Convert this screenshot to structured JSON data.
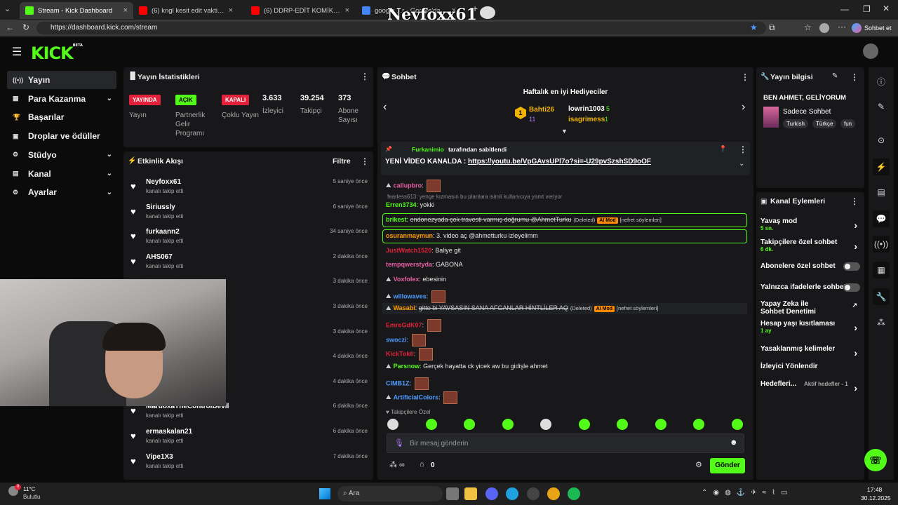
{
  "browser": {
    "tabs": [
      {
        "label": "Stream - Kick Dashboard",
        "color": "#53fc18"
      },
      {
        "label": "(6) kngl kesit edit vakti 1 - YouTub",
        "color": "#ff0000"
      },
      {
        "label": "(6) DDRP-EDİT KOMİK ANLAR 1 - Y",
        "color": "#ff0000"
      },
      {
        "label": "google ...r - Google'da Ara",
        "color": "#4285f4"
      }
    ],
    "url": "https://dashboard.kick.com/stream",
    "overlay_name": "Neyfoxx61",
    "profile_label": "Sohbet et"
  },
  "kick": {
    "logo": "KICK",
    "logo_sup": "BETA"
  },
  "sidebar": {
    "items": [
      {
        "label": "Yayın",
        "icon": "stream-icon",
        "selected": true,
        "chevron": false
      },
      {
        "label": "Para Kazanma",
        "icon": "money-icon",
        "chevron": true
      },
      {
        "label": "Başarılar",
        "icon": "trophy-icon",
        "chevron": false
      },
      {
        "label": "Droplar ve ödüller",
        "icon": "gift-icon",
        "chevron": false
      },
      {
        "label": "Stüdyo",
        "icon": "studio-icon",
        "chevron": true
      },
      {
        "label": "Kanal",
        "icon": "channel-icon",
        "chevron": true
      },
      {
        "label": "Ayarlar",
        "icon": "settings-icon",
        "chevron": true
      }
    ]
  },
  "stats": {
    "title": "Yayın İstatistikleri",
    "items": [
      {
        "badge": "YAYINDA",
        "badge_color": "#e3213b",
        "label": "Yayın"
      },
      {
        "badge": "AÇIK",
        "badge_color": "#53fc18",
        "label": "Partnerlik Gelir Programı"
      },
      {
        "badge": "KAPALI",
        "badge_color": "#e3213b",
        "label": "Çoklu Yayın"
      },
      {
        "value": "3.633",
        "label": "İzleyici"
      },
      {
        "value": "39.254",
        "label": "Takipçi"
      },
      {
        "value": "373",
        "label": "Abone Sayısı"
      }
    ]
  },
  "activity": {
    "title": "Etkinlik Akışı",
    "filter": "Filtre",
    "items": [
      {
        "name": "Neyfoxx61",
        "sub": "kanalı takip etti",
        "time": "5 saniye önce"
      },
      {
        "name": "Siriussly",
        "sub": "kanalı takip etti",
        "time": "6 saniye önce"
      },
      {
        "name": "furkaann2",
        "sub": "kanalı takip etti",
        "time": "34 saniye önce"
      },
      {
        "name": "AHS067",
        "sub": "kanalı takip etti",
        "time": "2 dakika önce"
      },
      {
        "name": "",
        "sub": "",
        "time": "3 dakika önce"
      },
      {
        "name": "",
        "sub": "",
        "time": "3 dakika önce"
      },
      {
        "name": "",
        "sub": "",
        "time": "3 dakika önce"
      },
      {
        "name": "",
        "sub": "",
        "time": "4 dakika önce"
      },
      {
        "name": "",
        "sub": "",
        "time": "4 dakika önce"
      },
      {
        "name": "MardoxaTheControlDevil",
        "sub": "kanalı takip etti",
        "time": "6 dakika önce"
      },
      {
        "name": "ermaskalan21",
        "sub": "kanalı takip etti",
        "time": "6 dakika önce"
      },
      {
        "name": "Vipe1X3",
        "sub": "kanalı takip etti",
        "time": "7 dakika önce"
      }
    ]
  },
  "chat": {
    "title": "Sohbet",
    "gifters_title": "Haftalık en iyi Hediyeciler",
    "gifters": [
      {
        "rank": "1",
        "name": "Bahti26",
        "count": "11"
      },
      {
        "name": "lowrin1003",
        "count": "5"
      },
      {
        "name": "isagrimess",
        "count": "1"
      }
    ],
    "pinned_by_user": "Furkanimio",
    "pinned_by_text": "tarafından sabitlendi",
    "pinned_msg": "YENİ VİDEO KANALDA : ",
    "pinned_link": "https://youtu.be/VpGAvsUPl7o?si=-U29pvSzshSD9oOF",
    "reply_hint": "fearless613: yenge kızmasın bu planlara isimli kullanıcıya yanıt veriyor",
    "messages": [
      {
        "user": "callupbro",
        "color": "#e75ea4",
        "text": "",
        "emote": true
      },
      {
        "user": "Erren3734",
        "color": "#53fc18",
        "text": "yokki"
      },
      {
        "user": "brikest",
        "color": "#53fc18",
        "text": "endonezyada çok travesti varmış doğrumu @AhmetTurku",
        "deleted": "(Deleted)",
        "ai": "AI Mod",
        "tag": "[nefret söylemleri]"
      },
      {
        "user": "osuranmaymun",
        "color": "#ff9d00",
        "text": "3. video aç @ahmetturku izleyelimm"
      },
      {
        "user": "JustWatch1520",
        "color": "#e3213b",
        "text": "Baliye git"
      },
      {
        "user": "tempqwerstyda",
        "color": "#e75ea4",
        "text": "GABONA"
      },
      {
        "user": "Voxfolex",
        "color": "#e75ea4",
        "text": "ebesinin"
      },
      {
        "user": "willowaves",
        "color": "#4d9bff",
        "text": "",
        "emote": true
      },
      {
        "user": "Wasabi",
        "color": "#ff9d00",
        "text": "gitte bi YAVSASIN SANA AFGANLAR HİNTLİLER AQ",
        "deleted": "(Deleted)",
        "ai": "AI Mod",
        "tag": "[nefret söylemleri]"
      },
      {
        "user": "EmreGdK07",
        "color": "#e3213b",
        "text": "",
        "emote": true
      },
      {
        "user": "swoczi",
        "color": "#4d9bff",
        "text": "",
        "emote": true
      },
      {
        "user": "KickTokti",
        "color": "#e3213b",
        "text": "",
        "emote": true
      },
      {
        "user": "Parsnow",
        "color": "#53fc18",
        "text": "Gerçek hayatta ck yicek aw bu gidişle ahmet"
      },
      {
        "user": "CIMB1Z",
        "color": "#4d9bff",
        "text": "",
        "emote": true
      },
      {
        "user": "ArtificialColors",
        "color": "#4d9bff",
        "text": "",
        "emote": true
      }
    ],
    "followers_only": "Takipçilere Özel",
    "input_placeholder": "Bir mesaj gönderin",
    "points": "0",
    "send_label": "Gönder"
  },
  "stream_info": {
    "title": "Yayın bilgisi",
    "stream_title": "BEN AHMET, GELİYORUM",
    "category": "Sadece Sohbet",
    "tags": [
      "Turkish",
      "Türkçe",
      "fun"
    ]
  },
  "channel_actions": {
    "title": "Kanal Eylemleri",
    "items": [
      {
        "label": "Yavaş mod",
        "sub": "5 sn.",
        "control": "chevron"
      },
      {
        "label": "Takipçilere özel sohbet",
        "sub": "6 dk.",
        "control": "chevron"
      },
      {
        "label": "Abonelere özel sohbet",
        "control": "toggle"
      },
      {
        "label": "Yalnızca ifadelerle sohbet",
        "control": "toggle"
      },
      {
        "label": "Yapay Zeka ile Sohbet Denetimi",
        "control": "external"
      },
      {
        "label": "Hesap yaşı kısıtlaması",
        "sub": "1 ay",
        "control": "chevron"
      },
      {
        "label": "Yasaklanmış kelimeler",
        "control": "chevron"
      },
      {
        "label": "İzleyici Yönlendir",
        "control": "none"
      },
      {
        "label": "Hedefleri...",
        "sub": "Aktif hedefler - 1",
        "control": "chevron"
      }
    ]
  },
  "taskbar": {
    "weather_temp": "11°C",
    "weather_text": "Bulutlu",
    "weather_badge": "9",
    "search_label": "Ara",
    "time": "17:48",
    "date": "30.12.2025"
  },
  "colors": {
    "brand": "#53fc18",
    "live": "#e3213b"
  }
}
